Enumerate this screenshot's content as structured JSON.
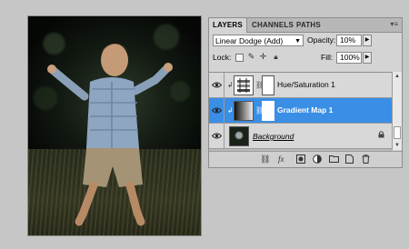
{
  "tabs": [
    {
      "label": "LAYERS",
      "active": true
    },
    {
      "label": "CHANNELS",
      "active": false
    },
    {
      "label": "PATHS",
      "active": false
    }
  ],
  "controls": {
    "blend_mode": "Linear Dodge (Add)",
    "opacity_label": "Opacity:",
    "opacity_value": "10%",
    "lock_label": "Lock:",
    "fill_label": "Fill:",
    "fill_value": "100%"
  },
  "layers": [
    {
      "name": "Hue/Saturation 1",
      "selected": false,
      "visible": true,
      "type": "adjustment"
    },
    {
      "name": "Gradient Map 1",
      "selected": true,
      "visible": true,
      "type": "adjustment"
    },
    {
      "name": "Background",
      "selected": false,
      "visible": true,
      "type": "image",
      "locked": true
    }
  ],
  "bottom_icons": [
    "link-icon",
    "fx-icon",
    "mask-icon",
    "adjustment-icon",
    "group-icon",
    "new-layer-icon",
    "trash-icon"
  ],
  "colors": {
    "selection": "#3a8ee6",
    "panel": "#d4d4d4",
    "background": "#c6c6c6"
  }
}
